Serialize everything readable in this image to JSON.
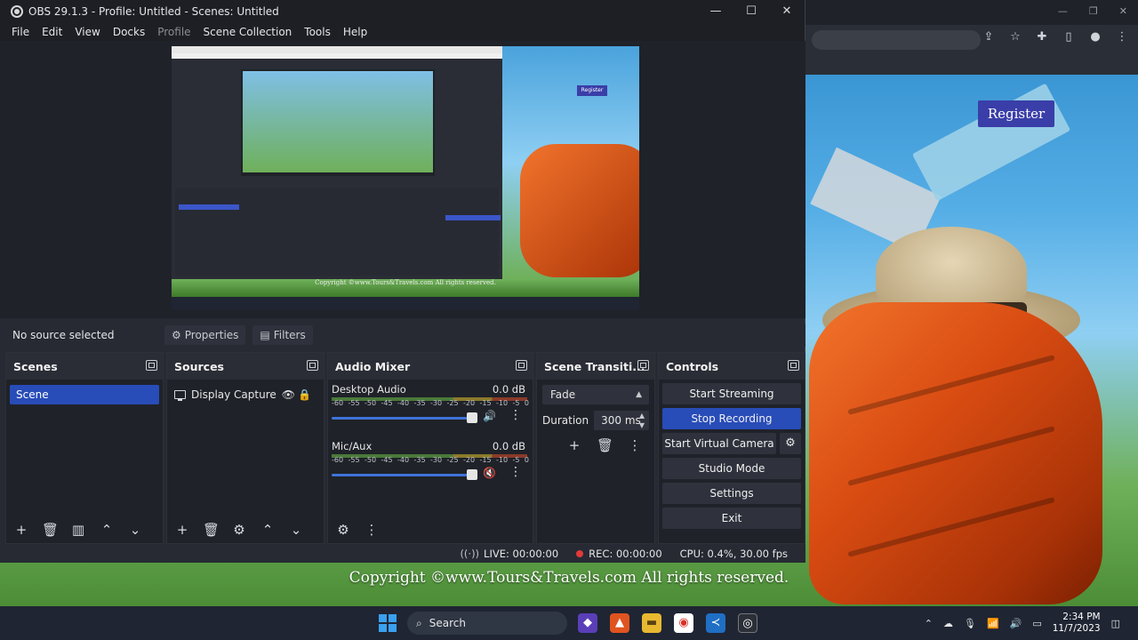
{
  "obs": {
    "title": "OBS 29.1.3 - Profile: Untitled - Scenes: Untitled",
    "menu": [
      "File",
      "Edit",
      "View",
      "Docks",
      "Profile",
      "Scene Collection",
      "Tools",
      "Help"
    ],
    "no_source": "No source selected",
    "properties_label": "Properties",
    "filters_label": "Filters"
  },
  "docks": {
    "scenes": {
      "title": "Scenes",
      "items": [
        "Scene"
      ]
    },
    "sources": {
      "title": "Sources",
      "items": [
        "Display Capture"
      ]
    },
    "mixer": {
      "title": "Audio Mixer",
      "ticks": [
        "-60",
        "-55",
        "-50",
        "-45",
        "-40",
        "-35",
        "-30",
        "-25",
        "-20",
        "-15",
        "-10",
        "-5",
        "0"
      ],
      "channels": [
        {
          "name": "Desktop Audio",
          "db": "0.0 dB",
          "muted": false
        },
        {
          "name": "Mic/Aux",
          "db": "0.0 dB",
          "muted": true
        }
      ]
    },
    "transitions": {
      "title": "Scene Transiti...",
      "selected": "Fade",
      "duration_label": "Duration",
      "duration_value": "300 ms"
    },
    "controls": {
      "title": "Controls",
      "start_streaming": "Start Streaming",
      "stop_recording": "Stop Recording",
      "start_virtual_camera": "Start Virtual Camera",
      "studio_mode": "Studio Mode",
      "settings": "Settings",
      "exit": "Exit"
    }
  },
  "status": {
    "live": "LIVE: 00:00:00",
    "rec": "REC: 00:00:00",
    "cpu": "CPU: 0.4%, 30.00 fps"
  },
  "background_page": {
    "register": "Register",
    "copyright": "Copyright ©www.Tours&Travels.com All rights reserved."
  },
  "preview": {
    "register": "Register",
    "copyright": "Copyright ©www.Tours&Travels.com All rights reserved."
  },
  "taskbar": {
    "search": "Search",
    "time": "2:34 PM",
    "date": "11/7/2023"
  },
  "colors": {
    "accent": "#284cb8",
    "dock_bg": "#1f2229",
    "rec": "#e03a3a"
  }
}
